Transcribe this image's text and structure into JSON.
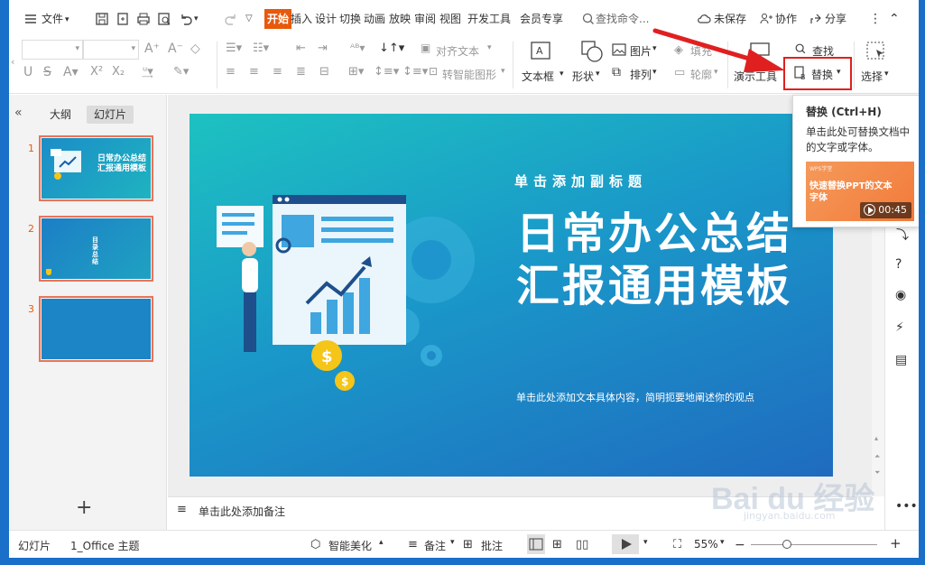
{
  "menubar": {
    "file_label": "文件",
    "tabs": [
      "开始",
      "插入",
      "设计",
      "切换",
      "动画",
      "放映",
      "审阅",
      "视图",
      "开发工具",
      "会员专享"
    ],
    "search_label": "查找命令...",
    "unsaved_label": "未保存",
    "collab_label": "协作",
    "share_label": "分享"
  },
  "ribbon": {
    "align_text_label": "对齐文本",
    "smartart_label": "转智能图形",
    "textbox_label": "文本框",
    "shape_label": "形状",
    "picture_label": "图片",
    "fill_label": "填充",
    "arrange_label": "排列",
    "outline_label": "轮廓",
    "presenter_label": "演示工具",
    "find_label": "查找",
    "replace_label": "替换",
    "select_label": "选择"
  },
  "leftpanel": {
    "outline_tab": "大纲",
    "slides_tab": "幻灯片",
    "thumb_numbers": [
      "1",
      "2",
      "3"
    ],
    "thumb1_title": "日常办公总结汇报通用模板",
    "thumb2_title": "目录总结"
  },
  "slide": {
    "subtitle": "单击添加副标题",
    "title": "日常办公总结汇报通用模板",
    "description": "单击此处添加文本具体内容，简明扼要地阐述你的观点"
  },
  "notes": {
    "placeholder": "单击此处添加备注"
  },
  "tooltip": {
    "title": "替换 (Ctrl+H)",
    "description": "单击此处可替换文档中的文字或字体。",
    "video_label": "快速替换PPT的文本字体",
    "video_tag": "WPS学堂",
    "duration": "00:45"
  },
  "statusbar": {
    "mode_label": "幻灯片",
    "theme_label": "1_Office 主题",
    "beautify_label": "智能美化",
    "notes_label": "备注",
    "comments_label": "批注",
    "zoom_label": "55%"
  },
  "watermark": {
    "brand": "Bai du 经验",
    "url": "jingyan.baidu.com"
  },
  "colors": {
    "accent": "#e8590c",
    "slide_start": "#1dc2c1",
    "slide_end": "#1f6bbf",
    "highlight": "#e02020"
  }
}
